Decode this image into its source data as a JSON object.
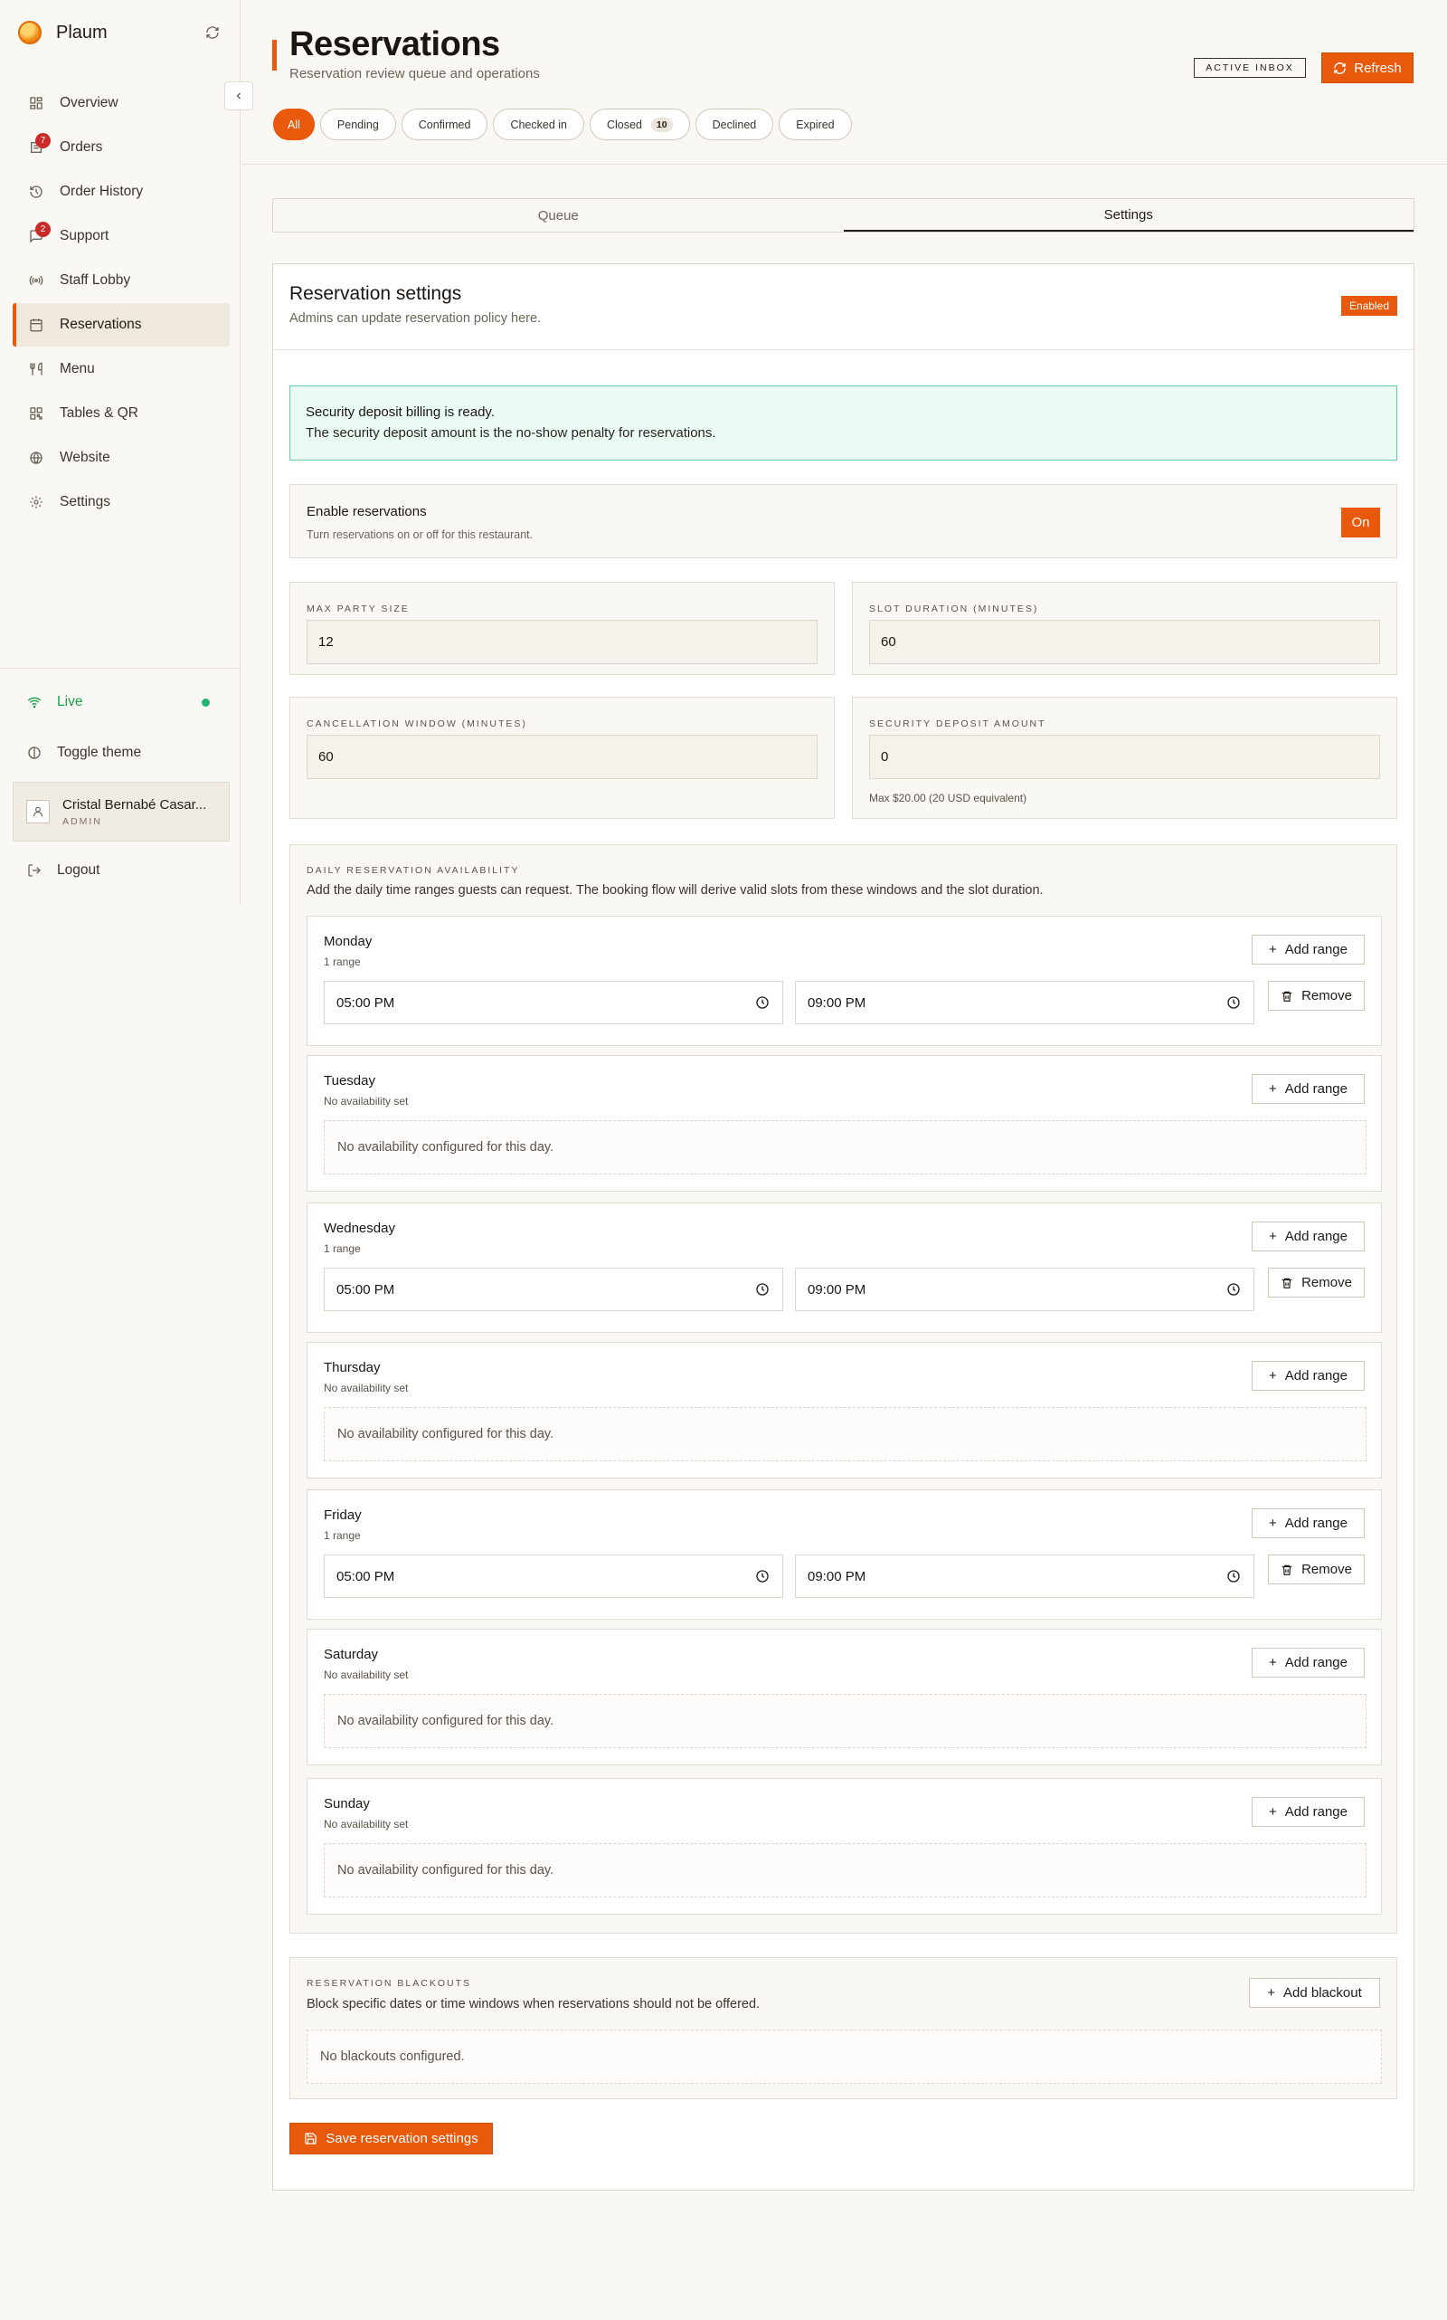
{
  "app": {
    "name": "Plaum"
  },
  "sidebar": {
    "items": [
      {
        "label": "Overview",
        "icon": "grid-icon"
      },
      {
        "label": "Orders",
        "icon": "orders-icon",
        "badge": "7"
      },
      {
        "label": "Order History",
        "icon": "history-icon"
      },
      {
        "label": "Support",
        "icon": "chat-icon",
        "badge": "2"
      },
      {
        "label": "Staff Lobby",
        "icon": "broadcast-icon"
      },
      {
        "label": "Reservations",
        "icon": "calendar-icon",
        "active": true
      },
      {
        "label": "Menu",
        "icon": "utensils-icon"
      },
      {
        "label": "Tables & QR",
        "icon": "qr-icon"
      },
      {
        "label": "Website",
        "icon": "globe-icon"
      },
      {
        "label": "Settings",
        "icon": "gear-icon"
      }
    ],
    "live_label": "Live",
    "theme_label": "Toggle theme",
    "user": {
      "name": "Cristal Bernabé Casar...",
      "role": "ADMIN"
    },
    "logout_label": "Logout"
  },
  "header": {
    "title": "Reservations",
    "subtitle": "Reservation review queue and operations",
    "active_inbox": "ACTIVE INBOX",
    "refresh_label": "Refresh",
    "filters": [
      {
        "label": "All",
        "active": true
      },
      {
        "label": "Pending"
      },
      {
        "label": "Confirmed"
      },
      {
        "label": "Checked in"
      },
      {
        "label": "Closed",
        "count": "10"
      },
      {
        "label": "Declined"
      },
      {
        "label": "Expired"
      }
    ]
  },
  "tabs": [
    {
      "label": "Queue"
    },
    {
      "label": "Settings",
      "selected": true
    }
  ],
  "settings": {
    "title": "Reservation settings",
    "subtitle": "Admins can update reservation policy here.",
    "status_badge": "Enabled",
    "alert": {
      "title": "Security deposit billing is ready.",
      "text": "The security deposit amount is the no-show penalty for reservations."
    },
    "enable": {
      "title": "Enable reservations",
      "subtitle": "Turn reservations on or off for this restaurant.",
      "toggle_label": "On"
    },
    "fields": {
      "max_party": {
        "label": "MAX PARTY SIZE",
        "value": "12"
      },
      "slot_duration": {
        "label": "SLOT DURATION (MINUTES)",
        "value": "60"
      },
      "cancellation": {
        "label": "CANCELLATION WINDOW (MINUTES)",
        "value": "60"
      },
      "deposit": {
        "label": "SECURITY DEPOSIT AMOUNT",
        "value": "0",
        "help": "Max $20.00 (20 USD equivalent)"
      }
    },
    "availability": {
      "label": "DAILY RESERVATION AVAILABILITY",
      "description": "Add the daily time ranges guests can request. The booking flow will derive valid slots from these windows and the slot duration.",
      "add_range_label": "Add range",
      "remove_label": "Remove",
      "empty_text": "No availability configured for this day.",
      "days": [
        {
          "name": "Monday",
          "summary": "1 range",
          "start": "05:00 PM",
          "end": "09:00 PM"
        },
        {
          "name": "Tuesday",
          "summary": "No availability set"
        },
        {
          "name": "Wednesday",
          "summary": "1 range",
          "start": "05:00 PM",
          "end": "09:00 PM"
        },
        {
          "name": "Thursday",
          "summary": "No availability set"
        },
        {
          "name": "Friday",
          "summary": "1 range",
          "start": "05:00 PM",
          "end": "09:00 PM"
        },
        {
          "name": "Saturday",
          "summary": "No availability set"
        },
        {
          "name": "Sunday",
          "summary": "No availability set"
        }
      ]
    },
    "blackouts": {
      "label": "RESERVATION BLACKOUTS",
      "description": "Block specific dates or time windows when reservations should not be offered.",
      "add_label": "Add blackout",
      "empty_text": "No blackouts configured."
    },
    "save_label": "Save reservation settings"
  },
  "colors": {
    "accent": "#e8590c",
    "success": "#22b573",
    "badge": "#c92a2a"
  }
}
